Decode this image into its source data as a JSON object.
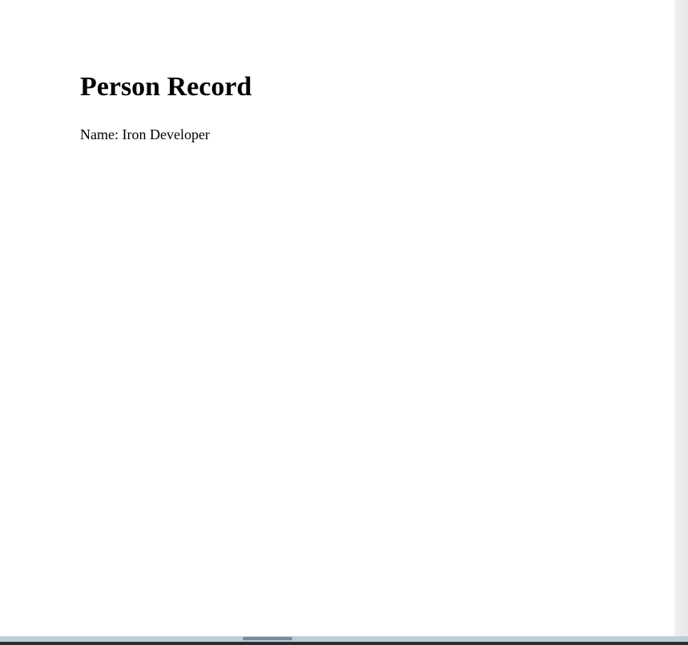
{
  "document": {
    "heading": "Person Record",
    "name_line": "Name: Iron Developer"
  }
}
